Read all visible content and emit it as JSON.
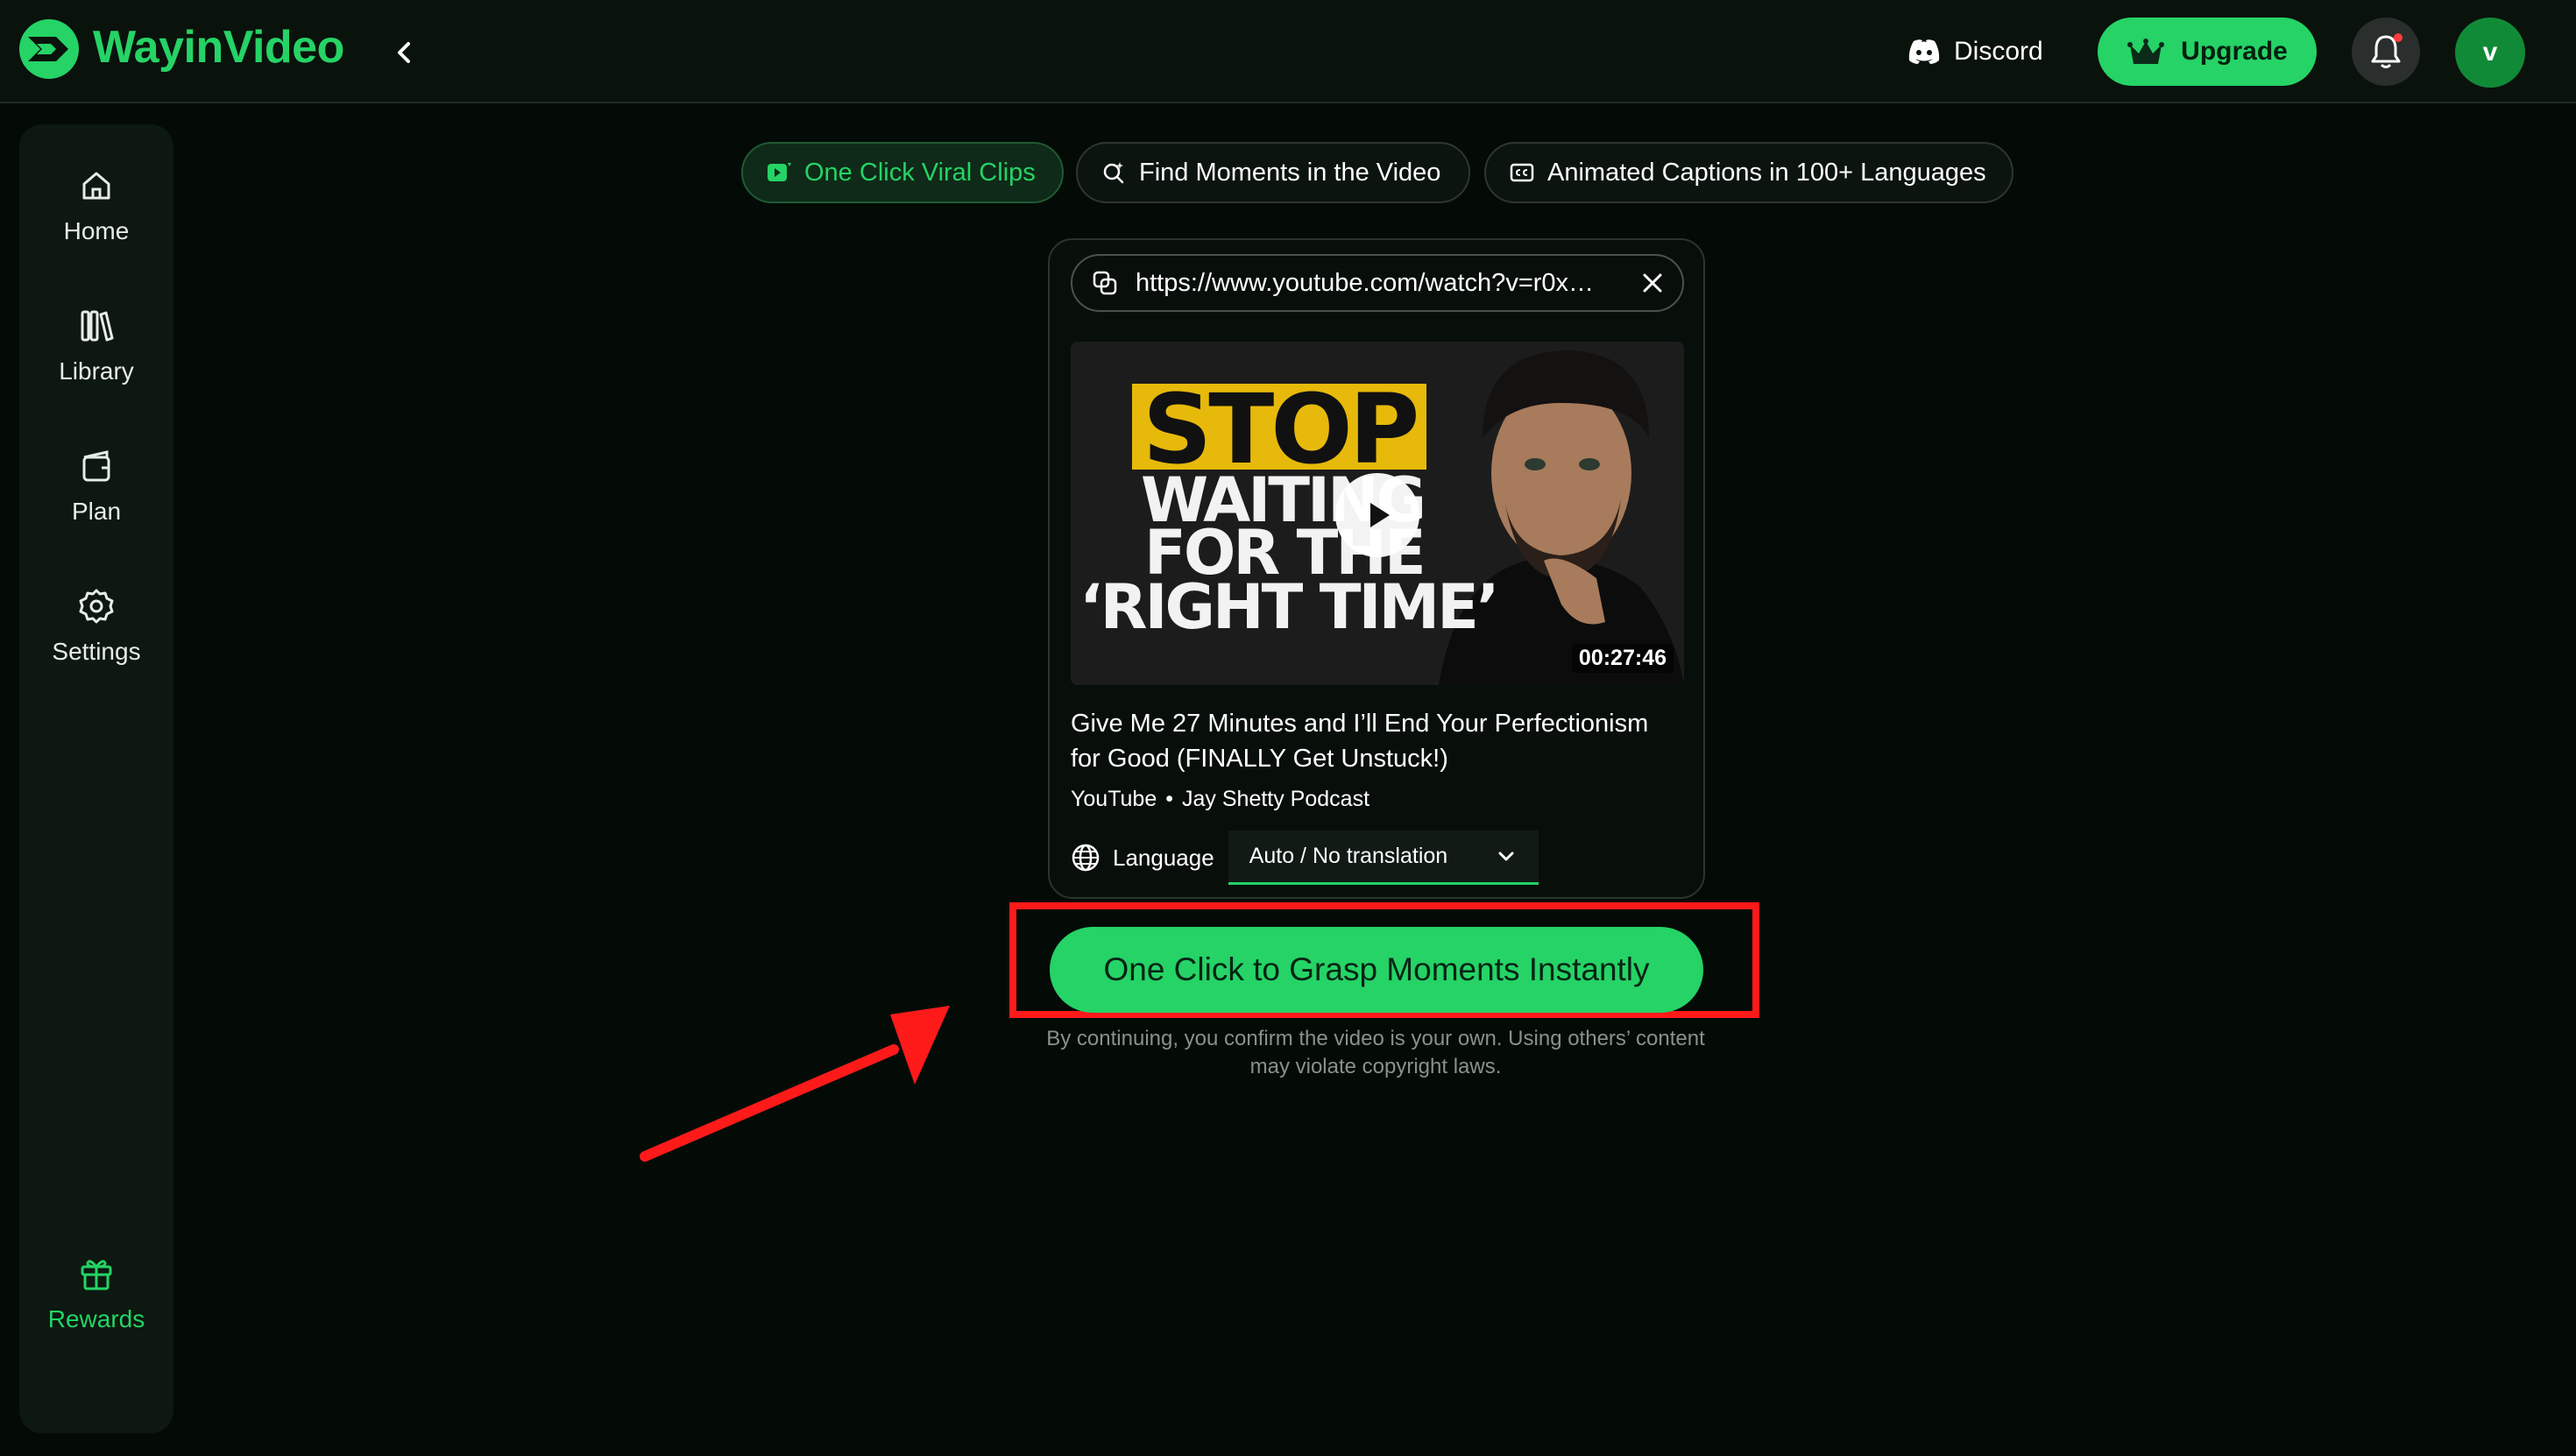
{
  "header": {
    "brand": "WayinVideo",
    "discord_label": "Discord",
    "upgrade_label": "Upgrade",
    "avatar_initial": "v"
  },
  "sidebar": {
    "items": [
      {
        "label": "Home",
        "icon": "home-icon"
      },
      {
        "label": "Library",
        "icon": "library-icon"
      },
      {
        "label": "Plan",
        "icon": "plan-icon"
      },
      {
        "label": "Settings",
        "icon": "gear-icon"
      }
    ],
    "rewards_label": "Rewards"
  },
  "tabs": [
    {
      "label": "One Click Viral Clips",
      "active": true
    },
    {
      "label": "Find Moments in the Video",
      "active": false
    },
    {
      "label": "Animated Captions in 100+ Languages",
      "active": false
    }
  ],
  "card": {
    "url": "https://www.youtube.com/watch?v=r0x…",
    "thumbnail": {
      "line1": "STOP",
      "line2": "WAITING",
      "line3": "FOR THE",
      "line4": "‘RIGHT TIME’",
      "duration": "00:27:46"
    },
    "title": "Give Me 27 Minutes and I’ll End Your Perfectionism for Good (FINALLY Get Unstuck!)",
    "source": "YouTube",
    "separator": "•",
    "channel": "Jay Shetty Podcast",
    "language_label": "Language",
    "language_value": "Auto / No translation"
  },
  "cta_label": "One Click to Grasp Moments Instantly",
  "disclaimer": "By continuing, you confirm the video is your own. Using others’ content may violate copyright laws.",
  "colors": {
    "accent": "#25d366",
    "background": "#040b06",
    "highlight": "#ff1a1a"
  }
}
